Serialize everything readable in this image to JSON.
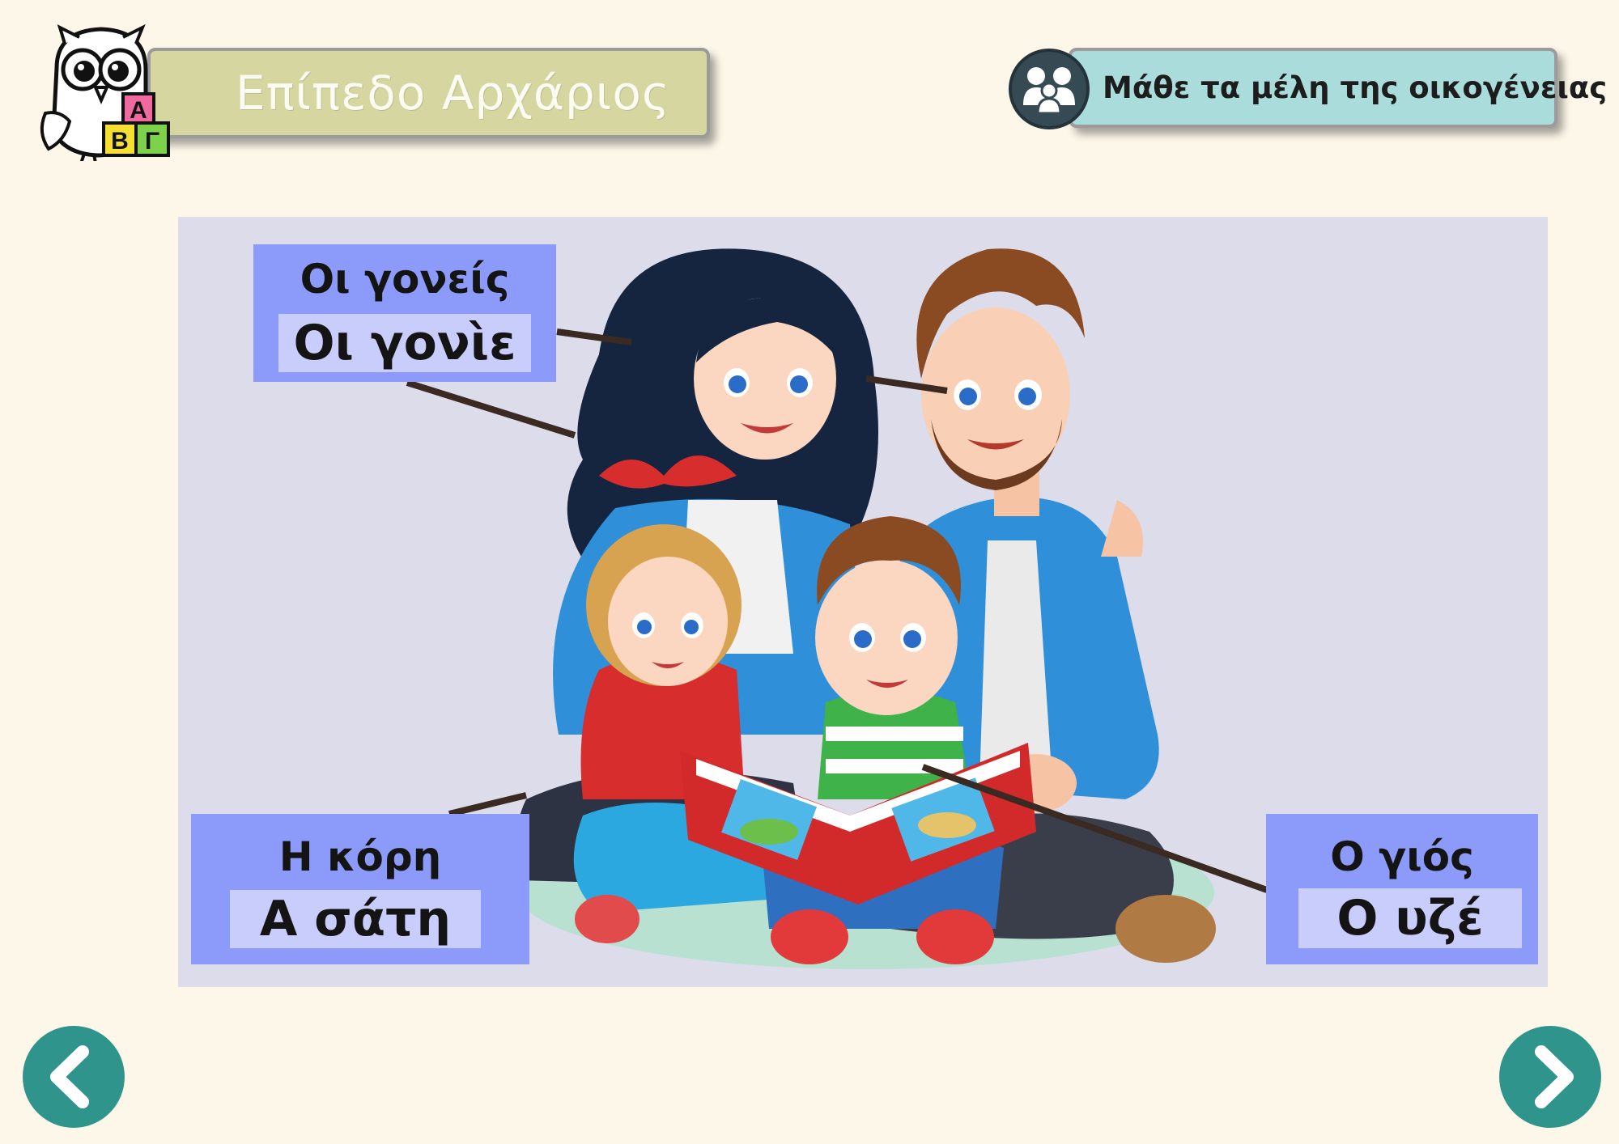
{
  "header": {
    "level_title": "Επίπεδο Αρχάριος",
    "section_title": "Μάθε τα μέλη της οικογένειας",
    "logo_letters": [
      "Α",
      "Β",
      "Γ"
    ]
  },
  "labels": {
    "parents": {
      "correct": "Οι γονείς",
      "scrambled": "Οι γονὶε"
    },
    "daughter": {
      "correct": "Η κόρη",
      "scrambled": "Α σάτη"
    },
    "son": {
      "correct": "Ο γιός",
      "scrambled": "Ο υζέ"
    }
  },
  "navigation": {
    "prev_icon": "chevron-left-icon",
    "next_icon": "chevron-right-icon"
  },
  "colors": {
    "background": "#fdf7e9",
    "level_banner": "#d6d6a1",
    "section_pill": "#a9dcdb",
    "label_box": "#8c9bf9",
    "label_inner": "#c9cdfc",
    "nav_button": "#2e948c",
    "panel": "#dcdcea"
  }
}
